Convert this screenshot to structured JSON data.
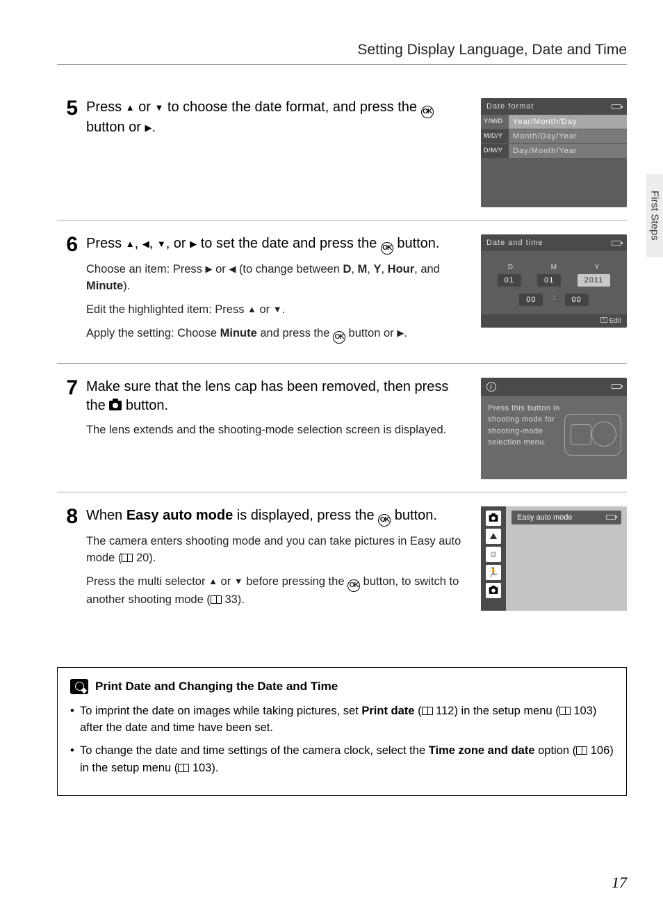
{
  "header": {
    "title": "Setting Display Language, Date and Time"
  },
  "sideTab": "First Steps",
  "pageNumber": "17",
  "steps": {
    "s5": {
      "num": "5",
      "main_a": "Press ",
      "main_b": " or ",
      "main_c": " to choose the date format, and press the ",
      "main_d": " button or ",
      "main_e": ".",
      "screen": {
        "title": "Date format",
        "rows": [
          {
            "code": "Y/M/D",
            "label": "Year/Month/Day"
          },
          {
            "code": "M/D/Y",
            "label": "Month/Day/Year"
          },
          {
            "code": "D/M/Y",
            "label": "Day/Month/Year"
          }
        ]
      }
    },
    "s6": {
      "num": "6",
      "main_a": "Press ",
      "main_comma": ", ",
      "main_or": ", or ",
      "main_b": " to set the date and press the ",
      "main_c": " button.",
      "sub1_a": "Choose an item: Press ",
      "sub1_b": " or ",
      "sub1_c": " (to change between ",
      "sub1_D": "D",
      "sub1_M": "M",
      "sub1_Y": "Y",
      "sub1_Hour": "Hour",
      "sub1_and": ", and ",
      "sub1_Minute": "Minute",
      "sub1_end": ").",
      "sub2_a": "Edit the highlighted item: Press ",
      "sub2_b": " or ",
      "sub2_c": ".",
      "sub3_a": "Apply the setting: Choose ",
      "sub3_m": "Minute",
      "sub3_b": " and press the ",
      "sub3_c": " button or ",
      "sub3_d": ".",
      "screen": {
        "title": "Date and time",
        "D": "D",
        "M": "M",
        "Y": "Y",
        "dVal": "01",
        "mVal": "01",
        "yVal": "2011",
        "hVal": "00",
        "minVal": "00",
        "edit": "Edit"
      }
    },
    "s7": {
      "num": "7",
      "main_a": "Make sure that the lens cap has been removed, then press the ",
      "main_b": " button.",
      "sub1": "The lens extends and the shooting-mode selection screen is displayed.",
      "screen": {
        "msg": "Press this button in shooting mode for shooting-mode selection menu."
      }
    },
    "s8": {
      "num": "8",
      "main_a": "When ",
      "main_mode": "Easy auto mode",
      "main_b": " is displayed, press the ",
      "main_c": " button.",
      "sub1_a": "The camera enters shooting mode and you can take pictures in Easy auto mode (",
      "sub1_ref": " 20).",
      "sub2_a": "Press the multi selector ",
      "sub2_b": " or ",
      "sub2_c": " before pressing the ",
      "sub2_d": " button, to switch to another shooting mode (",
      "sub2_ref": " 33).",
      "screen": {
        "label": "Easy auto mode"
      }
    }
  },
  "note": {
    "title": "Print Date and Changing the Date and Time",
    "b1_a": "To imprint the date on images while taking pictures, set ",
    "b1_pd": "Print date",
    "b1_b": " (",
    "b1_ref1": " 112) in the setup menu (",
    "b1_ref2": " 103) after the date and time have been set.",
    "b2_a": "To change the date and time settings of the camera clock, select the ",
    "b2_tz": "Time zone and date",
    "b2_b": " option (",
    "b2_ref1": " 106) in the setup menu (",
    "b2_ref2": " 103)."
  }
}
